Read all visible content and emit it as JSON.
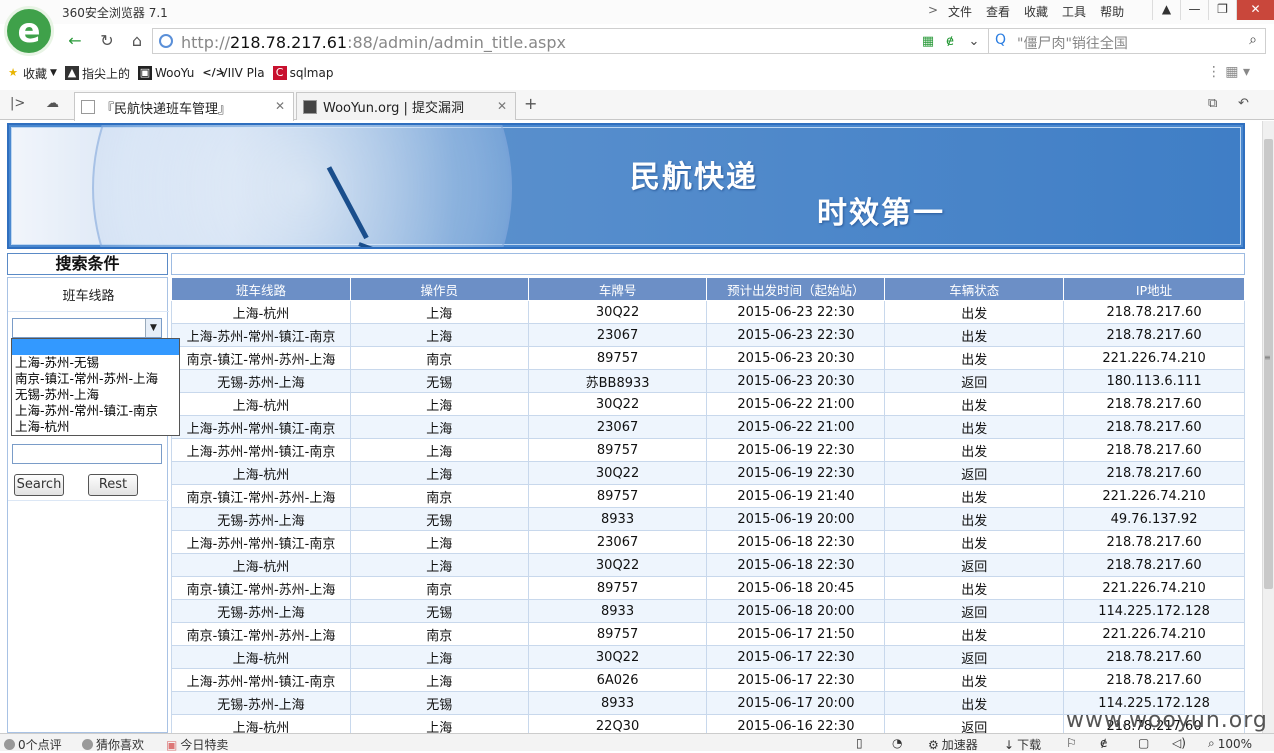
{
  "browser": {
    "app_title": "360安全浏览器 7.1",
    "menus": [
      "文件",
      "查看",
      "收藏",
      "工具",
      "帮助"
    ],
    "address": {
      "scheme": "http://",
      "host": "218.78.217.61",
      "path": ":88/admin/admin_title.aspx"
    },
    "search_placeholder": "\"僵尸肉\"销往全国",
    "bookmarks": [
      "收藏",
      "指尖上的",
      "WooYu",
      "VIIV Pla",
      "sqlmap"
    ],
    "tabs": [
      {
        "label": "『民航快递班车管理』",
        "active": true
      },
      {
        "label": "WooYun.org | 提交漏洞",
        "active": false
      }
    ]
  },
  "banner": {
    "title": "民航快递",
    "slogan": "时效第一"
  },
  "sidebar": {
    "heading": "搜索条件",
    "route_label": "班车线路",
    "route_select": {
      "selected": "",
      "options": [
        "",
        "上海-苏州-无锡",
        "南京-镇江-常州-苏州-上海",
        "无锡-苏州-上海",
        "上海-苏州-常州-镇江-南京",
        "上海-杭州"
      ]
    },
    "search_button": "Search",
    "reset_button": "Rest"
  },
  "table": {
    "headers": [
      "班车线路",
      "操作员",
      "车牌号",
      "预计出发时间（起始站）",
      "车辆状态",
      "IP地址"
    ],
    "rows": [
      [
        "上海-杭州",
        "上海",
        "30Q22",
        "2015-06-23 22:30",
        "出发",
        "218.78.217.60"
      ],
      [
        "上海-苏州-常州-镇江-南京",
        "上海",
        "23067",
        "2015-06-23 22:30",
        "出发",
        "218.78.217.60"
      ],
      [
        "南京-镇江-常州-苏州-上海",
        "南京",
        "89757",
        "2015-06-23 20:30",
        "出发",
        "221.226.74.210"
      ],
      [
        "无锡-苏州-上海",
        "无锡",
        "苏BB8933",
        "2015-06-23 20:30",
        "返回",
        "180.113.6.111"
      ],
      [
        "上海-杭州",
        "上海",
        "30Q22",
        "2015-06-22 21:00",
        "出发",
        "218.78.217.60"
      ],
      [
        "上海-苏州-常州-镇江-南京",
        "上海",
        "23067",
        "2015-06-22 21:00",
        "出发",
        "218.78.217.60"
      ],
      [
        "上海-苏州-常州-镇江-南京",
        "上海",
        "89757",
        "2015-06-19 22:30",
        "出发",
        "218.78.217.60"
      ],
      [
        "上海-杭州",
        "上海",
        "30Q22",
        "2015-06-19 22:30",
        "返回",
        "218.78.217.60"
      ],
      [
        "南京-镇江-常州-苏州-上海",
        "南京",
        "89757",
        "2015-06-19 21:40",
        "出发",
        "221.226.74.210"
      ],
      [
        "无锡-苏州-上海",
        "无锡",
        "8933",
        "2015-06-19 20:00",
        "出发",
        "49.76.137.92"
      ],
      [
        "上海-苏州-常州-镇江-南京",
        "上海",
        "23067",
        "2015-06-18 22:30",
        "出发",
        "218.78.217.60"
      ],
      [
        "上海-杭州",
        "上海",
        "30Q22",
        "2015-06-18 22:30",
        "返回",
        "218.78.217.60"
      ],
      [
        "南京-镇江-常州-苏州-上海",
        "南京",
        "89757",
        "2015-06-18 20:45",
        "出发",
        "221.226.74.210"
      ],
      [
        "无锡-苏州-上海",
        "无锡",
        "8933",
        "2015-06-18 20:00",
        "返回",
        "114.225.172.128"
      ],
      [
        "南京-镇江-常州-苏州-上海",
        "南京",
        "89757",
        "2015-06-17 21:50",
        "出发",
        "221.226.74.210"
      ],
      [
        "上海-杭州",
        "上海",
        "30Q22",
        "2015-06-17 22:30",
        "返回",
        "218.78.217.60"
      ],
      [
        "上海-苏州-常州-镇江-南京",
        "上海",
        "6A026",
        "2015-06-17 22:30",
        "出发",
        "218.78.217.60"
      ],
      [
        "无锡-苏州-上海",
        "无锡",
        "8933",
        "2015-06-17 20:00",
        "出发",
        "114.225.172.128"
      ],
      [
        "上海-杭州",
        "上海",
        "22Q30",
        "2015-06-16 22:30",
        "返回",
        "218.78.217.60"
      ]
    ]
  },
  "statusbar": {
    "left": [
      "0个点评",
      "猜你喜欢",
      "今日特卖"
    ],
    "right": [
      "加速器",
      "下载"
    ],
    "zoom": "100%"
  },
  "watermark": "www.wooyun.org"
}
